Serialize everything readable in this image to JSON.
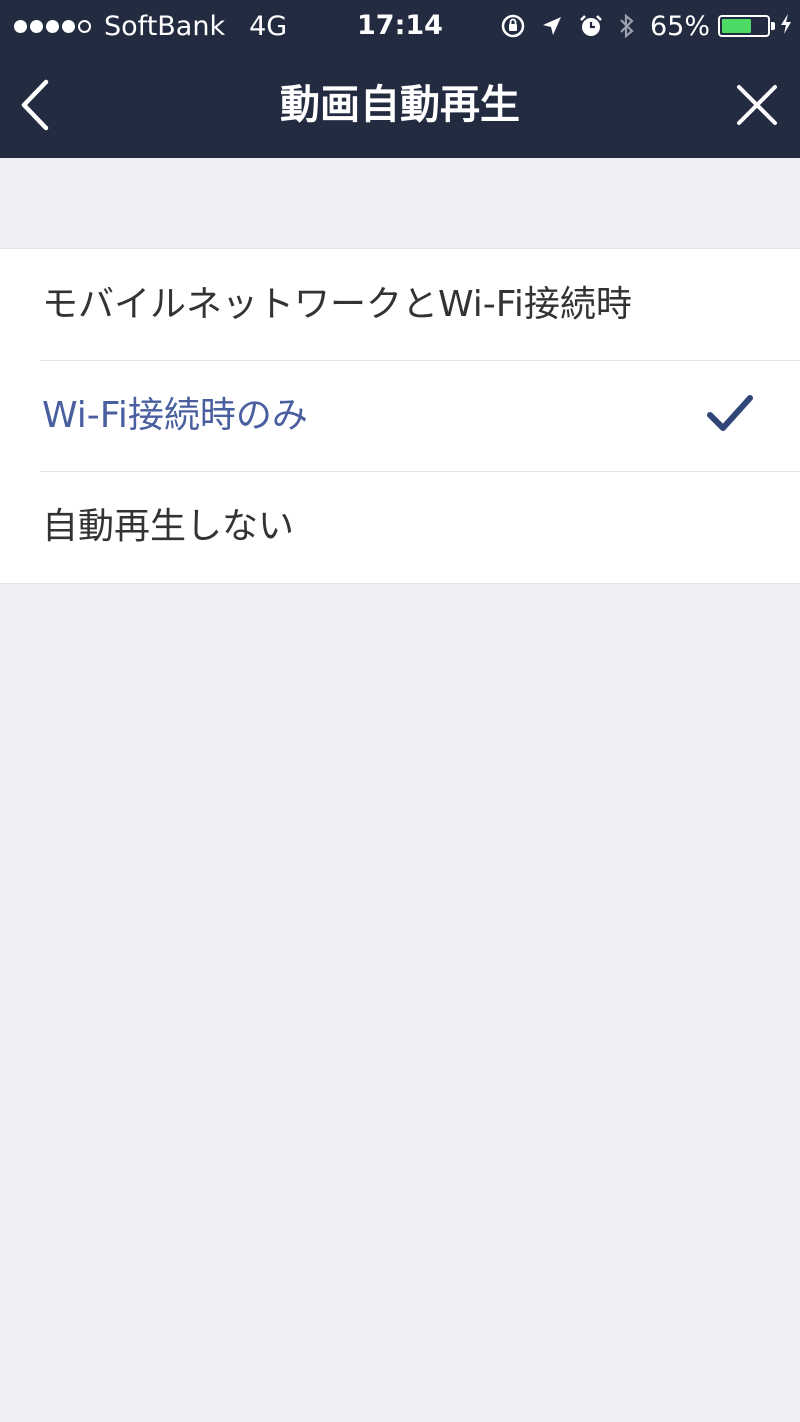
{
  "status_bar": {
    "carrier": "SoftBank",
    "network": "4G",
    "time": "17:14",
    "battery_percent": "65%",
    "battery_level": 0.65,
    "signal_bars_filled": 4,
    "signal_bars_total": 5,
    "icons": [
      "rotation-lock-icon",
      "location-icon",
      "alarm-icon",
      "bluetooth-icon",
      "charging-icon"
    ],
    "battery_color": "#4cd964"
  },
  "nav": {
    "title": "動画自動再生",
    "back_icon": "chevron-left-icon",
    "close_icon": "close-icon",
    "background_color": "#232b41"
  },
  "options": [
    {
      "label": "モバイルネットワークとWi-Fi接続時",
      "selected": false
    },
    {
      "label": "Wi-Fi接続時のみ",
      "selected": true
    },
    {
      "label": "自動再生しない",
      "selected": false
    }
  ],
  "colors": {
    "selected_text": "#4a5fa0",
    "check": "#2f4676",
    "page_background": "#efeff4"
  }
}
